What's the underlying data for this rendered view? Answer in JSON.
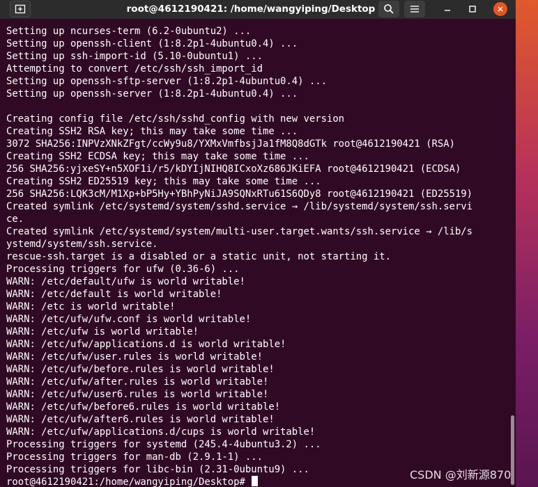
{
  "window": {
    "title": "root@4612190421: /home/wangyiping/Desktop"
  },
  "theme": {
    "terminal_bg": "#300a24",
    "titlebar_bg": "#2c2c2c",
    "close_button": "#e95420",
    "text": "#ffffff"
  },
  "icons": {
    "new_tab": "new-tab-icon",
    "search": "search-icon",
    "menu": "hamburger-menu-icon",
    "minimize": "minimize-icon",
    "maximize": "maximize-icon",
    "close": "close-icon"
  },
  "terminal": {
    "lines": [
      "Setting up ncurses-term (6.2-0ubuntu2) ...",
      "Setting up openssh-client (1:8.2p1-4ubuntu0.4) ...",
      "Setting up ssh-import-id (5.10-0ubuntu1) ...",
      "Attempting to convert /etc/ssh/ssh_import_id",
      "Setting up openssh-sftp-server (1:8.2p1-4ubuntu0.4) ...",
      "Setting up openssh-server (1:8.2p1-4ubuntu0.4) ...",
      "",
      "Creating config file /etc/ssh/sshd_config with new version",
      "Creating SSH2 RSA key; this may take some time ...",
      "3072 SHA256:INPVzXNkZFgt/ccWy9u8/YXMxVmfbsjJa1fM8Q8dGTk root@4612190421 (RSA)",
      "Creating SSH2 ECDSA key; this may take some time ...",
      "256 SHA256:yjxeSY+n5XOF1i/r5/kDYIjNIHQ8ICxoXz686JKiEFA root@4612190421 (ECDSA)",
      "Creating SSH2 ED25519 key; this may take some time ...",
      "256 SHA256:LQK3cM/M1Xp+bP5Hy+YBhPyNiJA9SQNxRTu61S6QDy8 root@4612190421 (ED25519)",
      "Created symlink /etc/systemd/system/sshd.service → /lib/systemd/system/ssh.servi",
      "ce.",
      "Created symlink /etc/systemd/system/multi-user.target.wants/ssh.service → /lib/s",
      "ystemd/system/ssh.service.",
      "rescue-ssh.target is a disabled or a static unit, not starting it.",
      "Processing triggers for ufw (0.36-6) ...",
      "WARN: /etc/default/ufw is world writable!",
      "WARN: /etc/default is world writable!",
      "WARN: /etc is world writable!",
      "WARN: /etc/ufw/ufw.conf is world writable!",
      "WARN: /etc/ufw is world writable!",
      "WARN: /etc/ufw/applications.d is world writable!",
      "WARN: /etc/ufw/user.rules is world writable!",
      "WARN: /etc/ufw/before.rules is world writable!",
      "WARN: /etc/ufw/after.rules is world writable!",
      "WARN: /etc/ufw/user6.rules is world writable!",
      "WARN: /etc/ufw/before6.rules is world writable!",
      "WARN: /etc/ufw/after6.rules is world writable!",
      "WARN: /etc/ufw/applications.d/cups is world writable!",
      "Processing triggers for systemd (245.4-4ubuntu3.2) ...",
      "Processing triggers for man-db (2.9.1-1) ...",
      "Processing triggers for libc-bin (2.31-0ubuntu9) ..."
    ],
    "prompt": "root@4612190421:/home/wangyiping/Desktop# "
  },
  "watermark": "CSDN @刘新源870"
}
